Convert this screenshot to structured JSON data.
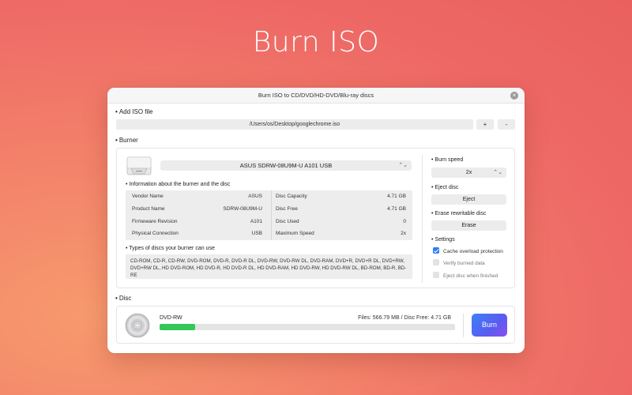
{
  "hero": {
    "title": "Burn ISO"
  },
  "window": {
    "title": "Burn ISO to CD/DVD/HD-DVD/Blu-ray discs"
  },
  "add_iso": {
    "label": "Add ISO file",
    "path": "/Users/os/Desktop/googlechrome.iso",
    "add_label": "+",
    "remove_label": "-"
  },
  "burner": {
    "label": "Burner",
    "selected": "ASUS SDRW-08U9M-U A101 USB",
    "info_label": "Information about the burner and the disc",
    "info_left": [
      {
        "key": "Vendor Name",
        "value": "ASUS"
      },
      {
        "key": "Product Name",
        "value": "SDRW-08U9M-U"
      },
      {
        "key": "Firmeware Revision",
        "value": "A101"
      },
      {
        "key": "Physical Connection",
        "value": "USB"
      }
    ],
    "info_right": [
      {
        "key": "Disc Capacity",
        "value": "4.71 GB"
      },
      {
        "key": "Disc Free",
        "value": "4.71 GB"
      },
      {
        "key": "Disc Used",
        "value": "0"
      },
      {
        "key": "Maximum Speed",
        "value": "2x"
      }
    ],
    "types_label": "Types of discs your burner can use",
    "types_text": "CD-ROM, CD-R, CD-RW, DVD-ROM, DVD-R, DVD-R DL, DVD-RW, DVD-RW DL, DVD-RAM, DVD+R, DVD+R DL, DVD+RW, DVD+RW DL, HD DVD-ROM, HD DVD-R, HD DVD-R DL, HD DVD-RAM, HD DVD-RW, HD DVD-RW DL, BD-ROM, BD-R, BD-RE"
  },
  "right_panel": {
    "speed_label": "Burn speed",
    "speed_value": "2x",
    "eject_label": "Eject disc",
    "eject_button": "Eject",
    "erase_label": "Erase rewritable disc",
    "erase_button": "Erase",
    "settings_label": "Settings",
    "settings": [
      {
        "label": "Cache overload protection",
        "checked": true
      },
      {
        "label": "Verify burned data",
        "checked": false
      },
      {
        "label": "Eject disc when finished",
        "checked": false
      }
    ]
  },
  "disc": {
    "label": "Disc",
    "type": "DVD-RW",
    "files_text": "Files: 566.79 MB / Disc Free: 4.71 GB",
    "progress": 0.12,
    "burn_button": "Burn"
  },
  "colors": {
    "progress": "#34c759",
    "checkbox_on": "#2f7cf6",
    "burn_gradient_start": "#3b82f6",
    "burn_gradient_end": "#8b4ff0"
  }
}
